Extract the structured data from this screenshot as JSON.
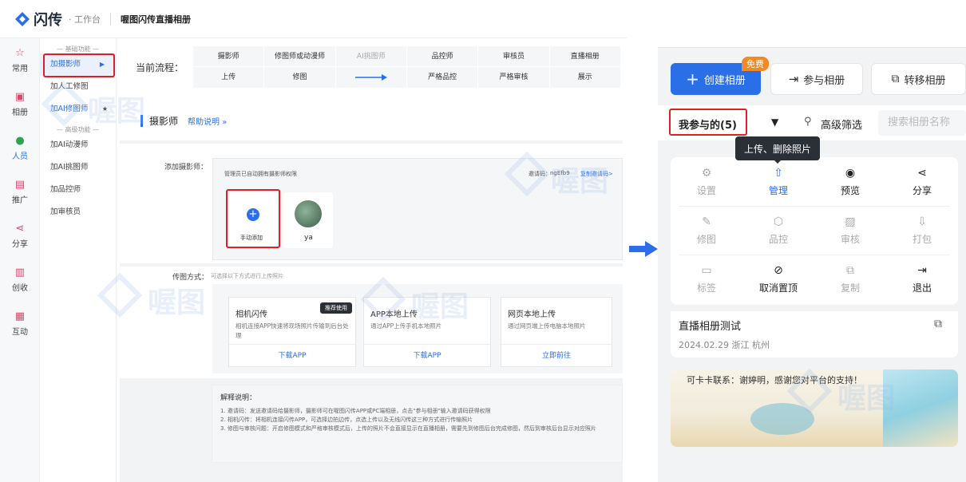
{
  "app": {
    "logo_name": "闪传",
    "logo_sub": "· 工作台",
    "page_title": "喔图闪传直播相册"
  },
  "rail": [
    {
      "icon": "star-icon",
      "glyph": "☆",
      "label": "常用"
    },
    {
      "icon": "album-icon",
      "glyph": "▣",
      "label": "相册"
    },
    {
      "icon": "people-icon",
      "glyph": "●",
      "label": "人员"
    },
    {
      "icon": "promote-icon",
      "glyph": "▤",
      "label": "推广"
    },
    {
      "icon": "share-icon",
      "glyph": "⋖",
      "label": "分享"
    },
    {
      "icon": "create-icon",
      "glyph": "▥",
      "label": "创收"
    },
    {
      "icon": "interact-icon",
      "glyph": "▦",
      "label": "互动"
    }
  ],
  "submenu": {
    "basic_head": "— 基础功能 —",
    "advanced_head": "— 高级功能 —",
    "basic": [
      "加摄影师",
      "加人工修图",
      "加AI修图师"
    ],
    "advanced": [
      "加AI动漫师",
      "加AI挑图师",
      "加品控师",
      "加审核员"
    ],
    "active_arrow": "▶",
    "star": "★"
  },
  "flow": {
    "label": "当前流程：",
    "columns": [
      {
        "role": "摄影师",
        "action": "上传"
      },
      {
        "role": "修图师或动漫师",
        "action": "修图"
      },
      {
        "role": "AI挑图师",
        "action": ""
      },
      {
        "role": "品控师",
        "action": "严格品控"
      },
      {
        "role": "审核员",
        "action": "严格审核"
      },
      {
        "role": "直播相册",
        "action": "展示"
      }
    ]
  },
  "section": {
    "title": "摄影师",
    "help": "帮助说明 »"
  },
  "add_photographer": {
    "label": "添加摄影师：",
    "note": "管理员已自动拥有摄影师权限",
    "invite_label": "邀请码：",
    "invite_code": "ngEfb9",
    "copy_link": "复制邀请码>",
    "manual_add": "手动添加",
    "member_name": "ya"
  },
  "transfer": {
    "label": "传图方式：",
    "hint": "可选择以下方式进行上传照片",
    "options": [
      {
        "title": "相机闪传",
        "badge": "推荐使用",
        "desc": "相机连接APP快速将现场照片传输到后台处理",
        "action": "下载APP"
      },
      {
        "title": "APP本地上传",
        "badge": "",
        "desc": "通过APP上传手机本地照片",
        "action": "下载APP"
      },
      {
        "title": "网页本地上传",
        "badge": "",
        "desc": "通过网页端上传电脑本地照片",
        "action": "立即前往"
      }
    ]
  },
  "explain": {
    "title": "解释说明：",
    "lines": [
      "1. 邀请码：发送邀请码给摄影师，摄影师可在喔图闪传APP或PC端相册，点击\"参与相册\"输入邀请码获得权限",
      "2. 相机闪传：将相机连接闪传APP，可选择边拍边传，点选上传以及无线闪传这三种方式进行传输照片",
      "3. 修图与审核问题：开启修图模式和严格审核模式后，上传的照片不会直接显示在直播相册，需要先到修图后台完成修图，然后到审核后台显示对应照片"
    ]
  },
  "watermark": "喔图",
  "mobile": {
    "create_button": "创建相册",
    "free_badge": "免费",
    "join_button": "参与相册",
    "transfer_button": "转移相册",
    "filter_label": "我参与的(5)",
    "advanced_filter": "高级筛选",
    "search_placeholder": "搜索相册名称",
    "tooltip": "上传、删除照片",
    "actions": [
      {
        "icon": "settings-icon",
        "glyph": "⚙",
        "label": "设置",
        "state": "disabled"
      },
      {
        "icon": "upload-icon",
        "glyph": "⇧",
        "label": "管理",
        "state": "highlight"
      },
      {
        "icon": "eye-icon",
        "glyph": "◉",
        "label": "预览",
        "state": "enabled"
      },
      {
        "icon": "share-icon",
        "glyph": "⋖",
        "label": "分享",
        "state": "enabled"
      },
      {
        "icon": "magic-wand-icon",
        "glyph": "✎",
        "label": "修图",
        "state": "disabled"
      },
      {
        "icon": "shield-icon",
        "glyph": "⬡",
        "label": "品控",
        "state": "disabled"
      },
      {
        "icon": "review-icon",
        "glyph": "▨",
        "label": "审核",
        "state": "disabled"
      },
      {
        "icon": "download-icon",
        "glyph": "⇩",
        "label": "打包",
        "state": "disabled"
      },
      {
        "icon": "tag-icon",
        "glyph": "▭",
        "label": "标签",
        "state": "disabled"
      },
      {
        "icon": "unpin-icon",
        "glyph": "⊘",
        "label": "取消置顶",
        "state": "enabled"
      },
      {
        "icon": "copy-icon",
        "glyph": "⧉",
        "label": "复制",
        "state": "disabled"
      },
      {
        "icon": "exit-icon",
        "glyph": "⇥",
        "label": "退出",
        "state": "enabled"
      }
    ],
    "album_title": "直播相册测试",
    "album_meta": "2024.02.29 浙江 杭州",
    "banner_text": "可卡卡联系：谢婷明，感谢您对平台的支持！"
  }
}
